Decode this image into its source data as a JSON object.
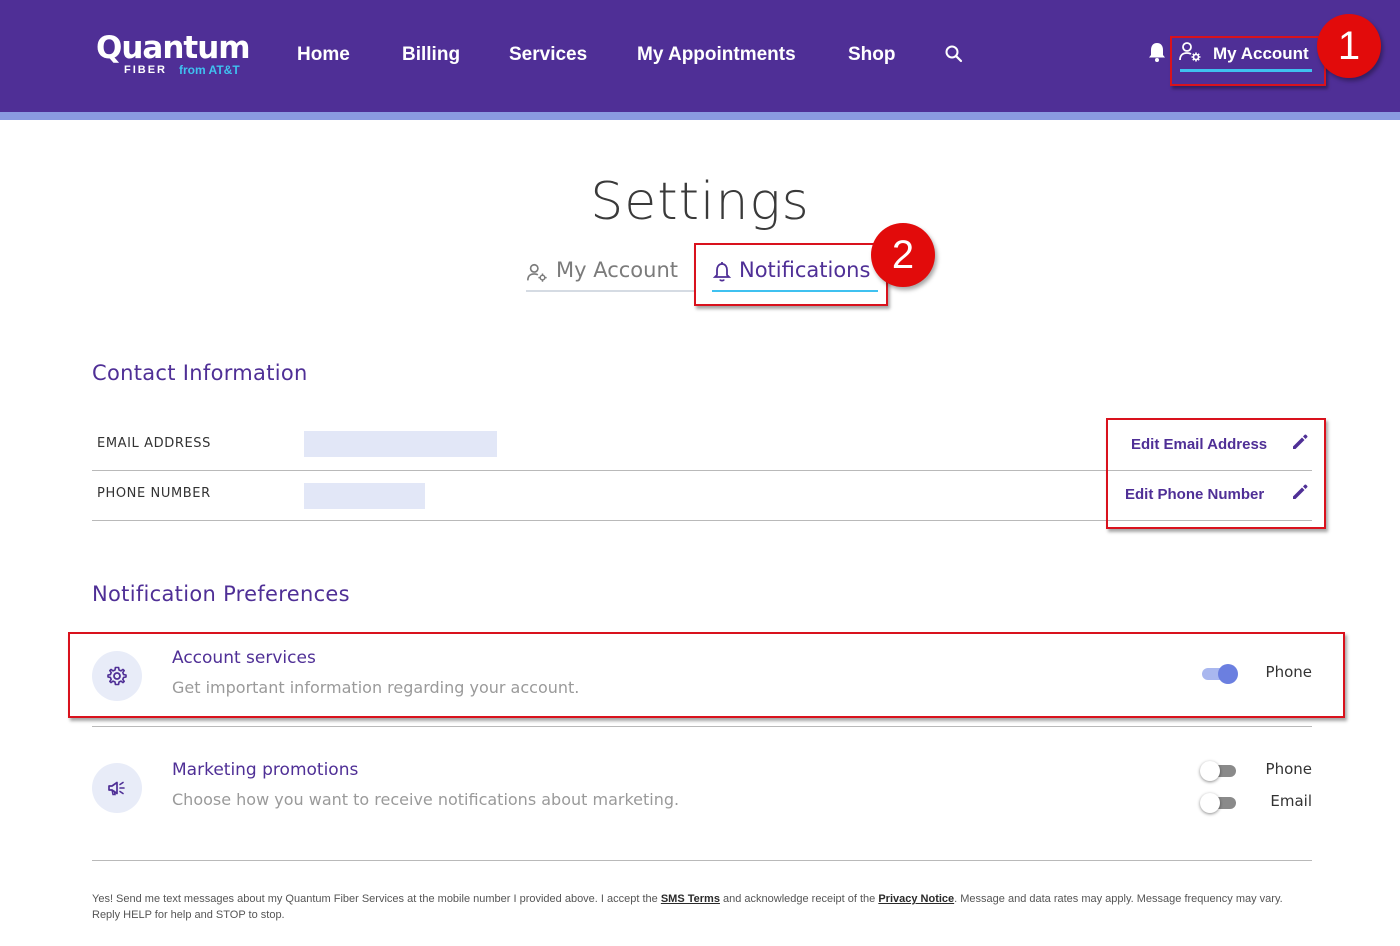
{
  "header": {
    "logo_main": "Quantum",
    "logo_fiber": "FIBER",
    "logo_att": "from AT&T",
    "nav": [
      "Home",
      "Billing",
      "Services",
      "My Appointments",
      "Shop"
    ],
    "my_account": "My Account",
    "icons": [
      "search-icon",
      "bell-icon",
      "user-gear-icon"
    ],
    "colors": {
      "bar": "#4f2f96",
      "stripe": "#8a9ae0",
      "accent": "#3fc1f0"
    }
  },
  "annotations": {
    "badge_1": "1",
    "badge_2": "2",
    "color": "#e20b0b"
  },
  "page": {
    "title": "Settings",
    "tabs": [
      {
        "label": "My Account",
        "active": false,
        "icon": "user-gear-icon"
      },
      {
        "label": "Notifications",
        "active": true,
        "icon": "bell-icon"
      }
    ]
  },
  "contact": {
    "title": "Contact Information",
    "rows": [
      {
        "label": "EMAIL ADDRESS",
        "action": "Edit Email Address",
        "icon": "pencil-icon"
      },
      {
        "label": "PHONE NUMBER",
        "action": "Edit Phone Number",
        "icon": "pencil-icon"
      }
    ]
  },
  "preferences": {
    "title": "Notification Preferences",
    "items": [
      {
        "title": "Account services",
        "subtitle": "Get important information regarding your account.",
        "icon": "gear-icon",
        "channels": [
          {
            "label": "Phone",
            "enabled": true
          }
        ]
      },
      {
        "title": "Marketing promotions",
        "subtitle": "Choose how you want to receive notifications about marketing.",
        "icon": "megaphone-icon",
        "channels": [
          {
            "label": "Phone",
            "enabled": false
          },
          {
            "label": "Email",
            "enabled": false
          }
        ]
      }
    ]
  },
  "footer": {
    "text_1": "Yes! Send me text messages about my Quantum Fiber Services at the mobile number I provided above. I accept the ",
    "sms_terms": "SMS Terms",
    "text_2": " and acknowledge receipt of the ",
    "privacy_notice": "Privacy Notice",
    "text_3": ". Message and data rates may apply. Message frequency may vary. Reply HELP for help and STOP to stop."
  }
}
